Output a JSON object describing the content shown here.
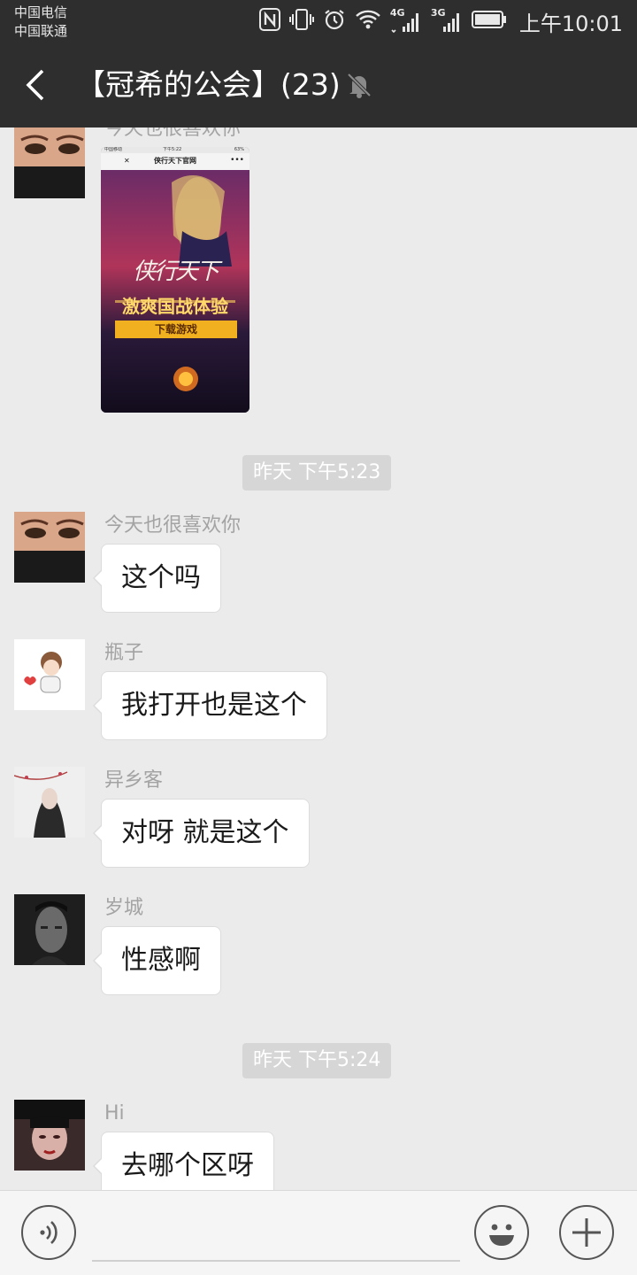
{
  "status_bar": {
    "carrier_1": "中国电信",
    "carrier_2": "中国联通",
    "signal_1_label": "4G",
    "signal_2_label": "3G",
    "time": "上午10:01"
  },
  "header": {
    "title": "【冠希的公会】(23)"
  },
  "game_image": {
    "status_carrier": "中国移动",
    "status_time": "下午5:22",
    "status_battery": "63%",
    "page_title": "侠行天下官网",
    "logo_text": "侠行天下",
    "slogan": "激爽国战体验",
    "download_label": "下载游戏"
  },
  "messages": [
    {
      "sender": "今天也很喜欢你"
    },
    {
      "type": "timestamp",
      "text": "昨天 下午5:23"
    },
    {
      "sender": "今天也很喜欢你",
      "text": "这个吗"
    },
    {
      "sender": "瓶子",
      "text": "我打开也是这个"
    },
    {
      "sender": "异乡客",
      "text": "对呀 就是这个"
    },
    {
      "sender": "岁城",
      "text": "性感啊"
    },
    {
      "type": "timestamp",
      "text": "昨天 下午5:24"
    },
    {
      "sender": "Hi",
      "text": "去哪个区呀"
    }
  ],
  "colors": {
    "bar_background": "#2e2e2e",
    "chat_background": "#ebebeb",
    "bubble_background": "#ffffff",
    "name_text": "#a3a3a3",
    "timestamp_background": "#d6d6d6"
  },
  "input_bar": {
    "voice_icon": "voice-icon",
    "emoji_icon": "emoji-icon",
    "plus_icon": "plus-icon"
  }
}
